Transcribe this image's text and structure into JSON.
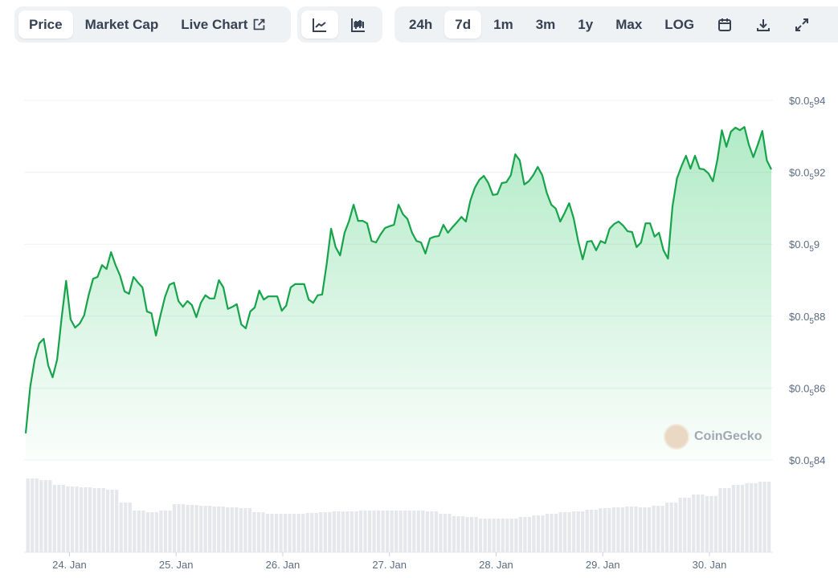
{
  "toolbar": {
    "metric_tabs": [
      "Price",
      "Market Cap",
      "Live Chart"
    ],
    "active_metric": "Price",
    "chart_types": [
      "line-chart-icon",
      "candlestick-icon"
    ],
    "ranges": [
      "24h",
      "7d",
      "1m",
      "3m",
      "1y",
      "Max",
      "LOG"
    ],
    "active_range": "7d",
    "tools": [
      "calendar-icon",
      "download-icon",
      "fullscreen-icon"
    ]
  },
  "watermark": "CoinGecko",
  "colors": {
    "line": "#16a34a",
    "fill": "#22c55e",
    "volume": "#e5e7eb",
    "grid": "#eef0f3"
  },
  "chart_data": {
    "type": "line",
    "title": "",
    "xlabel": "",
    "ylabel": "",
    "y_multiplier": 1e-07,
    "ylim": [
      84,
      94
    ],
    "yticks": [
      94,
      92,
      90,
      88,
      86,
      84
    ],
    "ytick_labels": [
      {
        "pre": "$0.0",
        "sub": "5",
        "post": "94"
      },
      {
        "pre": "$0.0",
        "sub": "5",
        "post": "92"
      },
      {
        "pre": "$0.0",
        "sub": "5",
        "post": "9"
      },
      {
        "pre": "$0.0",
        "sub": "5",
        "post": "88"
      },
      {
        "pre": "$0.0",
        "sub": "5",
        "post": "86"
      },
      {
        "pre": "$0.0",
        "sub": "5",
        "post": "84"
      }
    ],
    "x_start_day": -0.41,
    "x_end_day": 6.58,
    "xtick_days": [
      0,
      1,
      2,
      3,
      4,
      5,
      6
    ],
    "xtick_labels": [
      "24. Jan",
      "25. Jan",
      "26. Jan",
      "27. Jan",
      "28. Jan",
      "29. Jan",
      "30. Jan"
    ],
    "grid": true,
    "price": [
      84.74,
      86.03,
      86.79,
      87.24,
      87.37,
      86.63,
      86.3,
      86.79,
      87.95,
      88.98,
      87.91,
      87.68,
      87.79,
      88.02,
      88.58,
      89.04,
      89.09,
      89.42,
      89.31,
      89.78,
      89.42,
      89.13,
      88.69,
      88.62,
      89.09,
      88.93,
      88.8,
      88.13,
      88.08,
      87.46,
      88.02,
      88.53,
      88.87,
      88.93,
      88.42,
      88.26,
      88.42,
      88.31,
      87.97,
      88.37,
      88.58,
      88.49,
      88.49,
      89.0,
      88.8,
      88.2,
      88.26,
      88.33,
      87.77,
      87.66,
      88.13,
      88.24,
      88.71,
      88.46,
      88.55,
      88.55,
      88.55,
      88.15,
      88.29,
      88.8,
      88.89,
      88.89,
      88.89,
      88.46,
      88.37,
      88.58,
      88.6,
      89.45,
      90.43,
      89.92,
      89.69,
      90.32,
      90.65,
      91.1,
      90.65,
      90.65,
      90.58,
      90.09,
      90.05,
      90.27,
      90.45,
      90.5,
      90.54,
      91.1,
      90.83,
      90.7,
      90.32,
      90.09,
      90.05,
      89.74,
      90.16,
      90.21,
      90.23,
      90.54,
      90.32,
      90.47,
      90.61,
      90.76,
      90.63,
      91.21,
      91.57,
      91.79,
      91.9,
      91.7,
      91.37,
      91.39,
      91.7,
      91.72,
      91.92,
      92.5,
      92.33,
      91.66,
      91.75,
      91.92,
      92.15,
      91.92,
      91.43,
      91.1,
      90.99,
      90.63,
      90.87,
      91.14,
      90.72,
      90.09,
      89.58,
      90.07,
      90.09,
      89.83,
      90.09,
      90.03,
      90.43,
      90.56,
      90.63,
      90.52,
      90.36,
      90.34,
      89.92,
      90.05,
      90.58,
      90.58,
      90.21,
      90.32,
      89.83,
      89.6,
      91.05,
      91.83,
      92.17,
      92.46,
      92.1,
      92.46,
      92.1,
      92.08,
      91.97,
      91.75,
      92.35,
      93.17,
      92.71,
      93.13,
      93.24,
      93.17,
      93.26,
      92.77,
      92.42,
      92.77,
      93.15,
      92.33,
      92.08
    ],
    "volume": [
      92,
      90,
      84,
      82,
      81,
      80,
      78,
      62,
      52,
      50,
      52,
      60,
      59,
      58,
      57,
      56,
      55,
      50,
      48,
      48,
      48,
      49,
      50,
      51,
      51,
      52,
      52,
      52,
      52,
      52,
      51,
      48,
      45,
      44,
      42,
      42,
      42,
      44,
      46,
      48,
      50,
      51,
      53,
      55,
      56,
      57,
      56,
      58,
      62,
      68,
      72,
      70,
      80,
      84,
      86,
      88
    ]
  }
}
